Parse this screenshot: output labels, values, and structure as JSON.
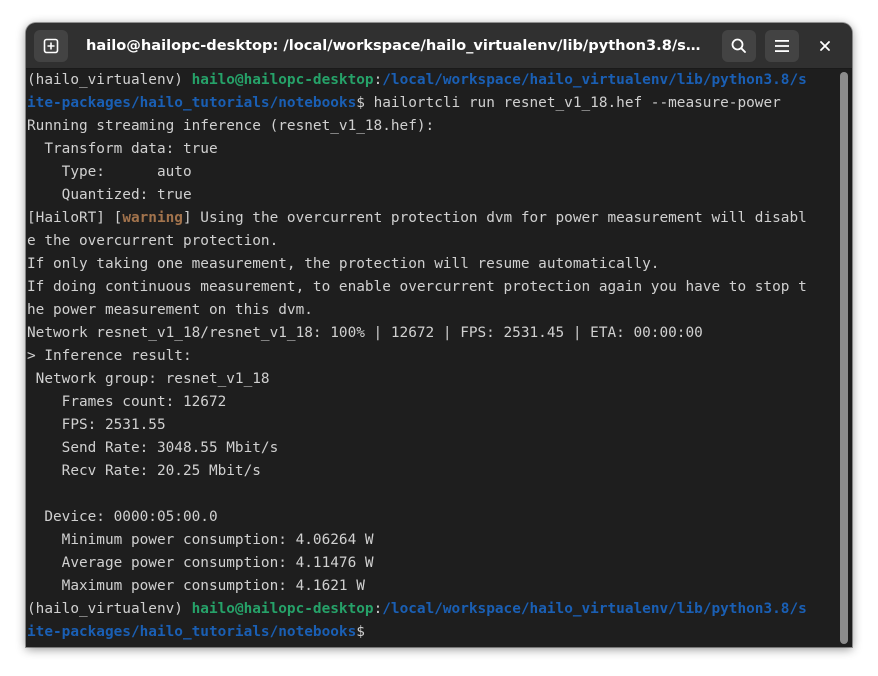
{
  "window": {
    "title": "hailo@hailopc-desktop: /local/workspace/hailo_virtualenv/lib/python3.8/s…"
  },
  "icons": {
    "new_tab": "new-tab-icon",
    "search": "search-icon",
    "menu": "hamburger-menu-icon",
    "close": "close-icon"
  },
  "colors": {
    "background": "#1e1e1e",
    "text": "#d0d0d0",
    "prompt_user": "#26a269",
    "prompt_path": "#1a5fb4",
    "warning": "#a2734c"
  },
  "terminal": {
    "prompt1": {
      "env": "(hailo_virtualenv) ",
      "user": "hailo@hailopc-desktop",
      "sep": ":",
      "path_a": "/local/workspace/hailo_virtualenv/lib/python3.8/s",
      "path_b": "ite-packages/hailo_tutorials/notebooks",
      "dollar": "$ ",
      "command": "hailortcli run resnet_v1_18.hef --measure-power"
    },
    "out": {
      "running": "Running streaming inference (resnet_v1_18.hef):",
      "transform": "  Transform data: true",
      "type": "    Type:      auto",
      "quantized": "    Quantized: true",
      "warn_open": "[HailoRT] [",
      "warn_word": "warning",
      "warn_rest": "] Using the overcurrent protection dvm for power measurement will disabl",
      "warn_cont": "e the overcurrent protection.",
      "only_one": "If only taking one measurement, the protection will resume automatically.",
      "continuous_a": "If doing continuous measurement, to enable overcurrent protection again you have to stop t",
      "continuous_b": "he power measurement on this dvm.",
      "network": "Network resnet_v1_18/resnet_v1_18: 100% | 12672 | FPS: 2531.45 | ETA: 00:00:00",
      "inference_result": "> Inference result:",
      "network_group": " Network group: resnet_v1_18",
      "frames_count": "    Frames count: 12672",
      "fps": "    FPS: 2531.55",
      "send_rate": "    Send Rate: 3048.55 Mbit/s",
      "recv_rate": "    Recv Rate: 20.25 Mbit/s",
      "device": "  Device: 0000:05:00.0",
      "min_power": "    Minimum power consumption: 4.06264 W",
      "avg_power": "    Average power consumption: 4.11476 W",
      "max_power": "    Maximum power consumption: 4.1621 W"
    },
    "prompt2": {
      "env": "(hailo_virtualenv) ",
      "user": "hailo@hailopc-desktop",
      "sep": ":",
      "path_a": "/local/workspace/hailo_virtualenv/lib/python3.8/s",
      "path_b": "ite-packages/hailo_tutorials/notebooks",
      "dollar": "$"
    }
  }
}
